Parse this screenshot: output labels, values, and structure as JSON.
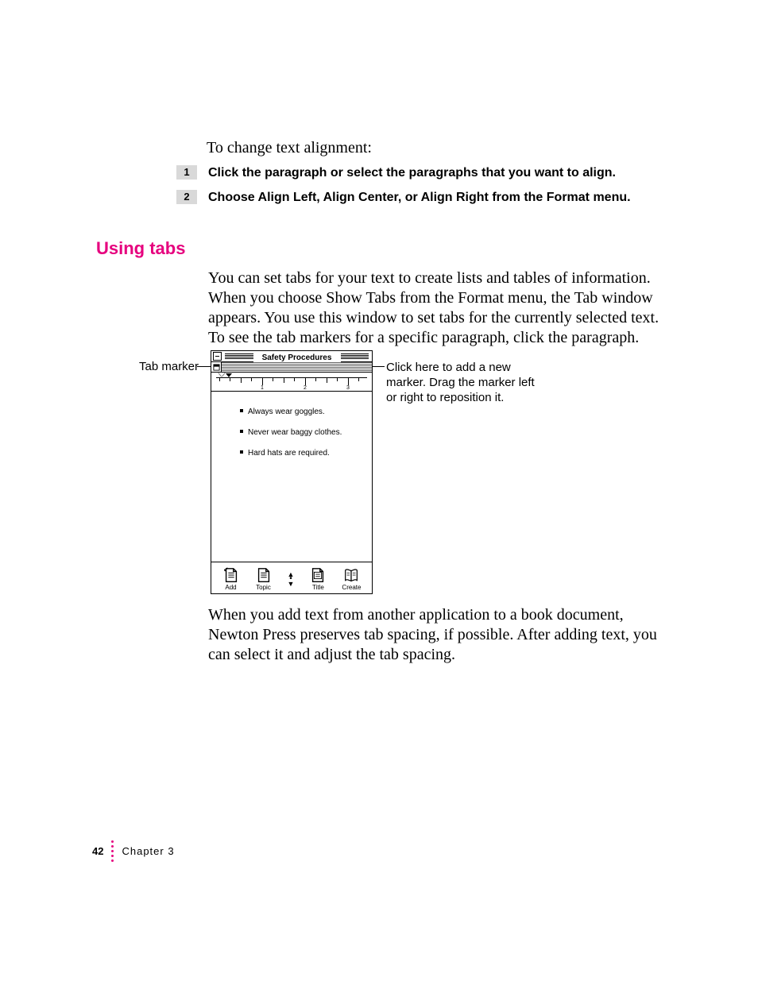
{
  "intro": "To change text alignment:",
  "steps": [
    {
      "num": "1",
      "text": "Click the paragraph or select the paragraphs that you want to align."
    },
    {
      "num": "2",
      "text": "Choose Align Left, Align Center, or Align Right from the Format menu."
    }
  ],
  "heading": "Using tabs",
  "para1": "You can set tabs for your text to create lists and tables of information. When you choose Show Tabs from the Format menu, the Tab window appears. You use this window to set tabs for the currently selected text. To see the tab markers for a specific paragraph, click the paragraph.",
  "para2": "When you add text from another application to a book document, Newton Press preserves tab spacing, if possible. After adding text, you can select it and adjust the tab spacing.",
  "callout_left": "Tab marker",
  "callout_right": "Click here to add a new marker. Drag the marker left or right to reposition it.",
  "figure": {
    "title": "Safety Procedures",
    "ruler_labels": [
      "1",
      "2",
      "3"
    ],
    "lines": [
      "Always wear goggles.",
      "Never wear baggy clothes.",
      "Hard hats are required."
    ],
    "tools": {
      "add": "Add",
      "topic": "Topic",
      "title": "Title",
      "create": "Create"
    }
  },
  "footer": {
    "page": "42",
    "chapter": "Chapter 3"
  }
}
